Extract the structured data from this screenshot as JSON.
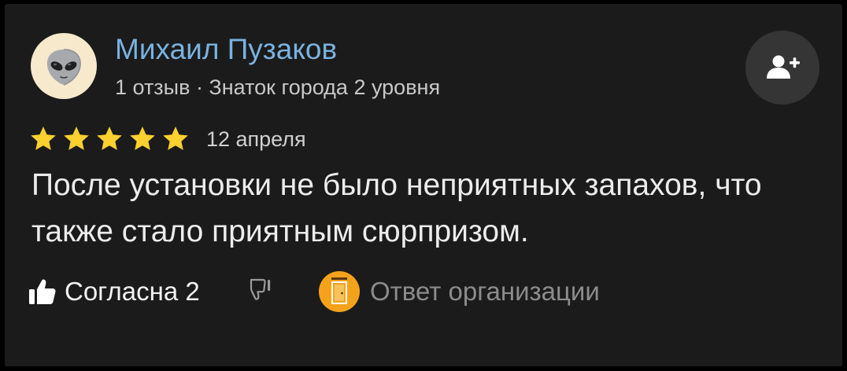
{
  "review": {
    "author": {
      "name": "Михаил Пузаков",
      "meta": "1 отзыв · Знаток города 2 уровня",
      "avatar_icon": "alien-emoji-icon"
    },
    "subscribe_icon": "add-user-icon",
    "rating": {
      "value": 5,
      "max": 5,
      "star_color": "#fcd02f"
    },
    "date": "12 апреля",
    "text": "После установки не было неприятных запахов, что также стало приятным сюрпризом.",
    "actions": {
      "like_label": "Согласна 2",
      "like_icon": "thumbs-up-icon",
      "dislike_icon": "thumbs-down-icon",
      "org_reply_label": "Ответ организации",
      "org_logo_icon": "door-logo-icon"
    }
  },
  "colors": {
    "background": "#1b1b1b",
    "author_name": "#7ab2e0",
    "org_logo_bg": "#f5a21b"
  }
}
